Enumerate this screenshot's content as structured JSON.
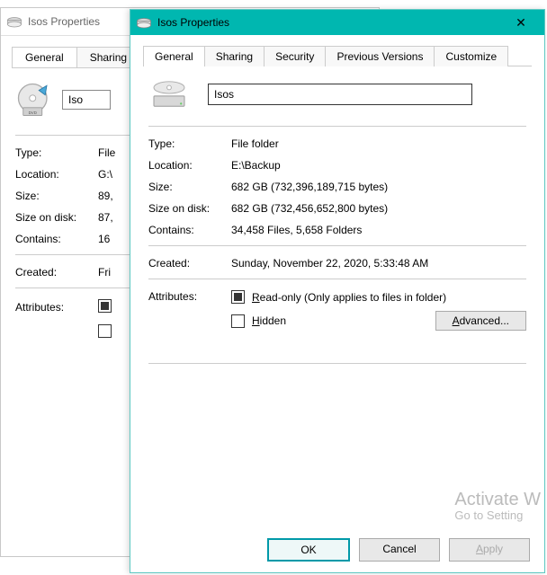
{
  "back": {
    "title": "Isos Properties",
    "tabs": {
      "general": "General",
      "sharing": "Sharing"
    },
    "name": "Iso",
    "type_label": "Type:",
    "type_value": "File",
    "location_label": "Location:",
    "location_value": "G:\\",
    "size_label": "Size:",
    "size_value": "89,",
    "disk_label": "Size on disk:",
    "disk_value": "87,",
    "contains_label": "Contains:",
    "contains_value": "16",
    "created_label": "Created:",
    "created_value": "Fri",
    "attributes_label": "Attributes:"
  },
  "front": {
    "title": "Isos Properties",
    "tabs": {
      "general": "General",
      "sharing": "Sharing",
      "security": "Security",
      "previous": "Previous Versions",
      "customize": "Customize"
    },
    "name": "Isos",
    "type_label": "Type:",
    "type_value": "File folder",
    "location_label": "Location:",
    "location_value": "E:\\Backup",
    "size_label": "Size:",
    "size_value": "682 GB (732,396,189,715 bytes)",
    "disk_label": "Size on disk:",
    "disk_value": "682 GB (732,456,652,800 bytes)",
    "contains_label": "Contains:",
    "contains_value": "34,458 Files, 5,658 Folders",
    "created_label": "Created:",
    "created_value": "Sunday, November 22, 2020, 5:33:48 AM",
    "attributes_label": "Attributes:",
    "readonly_label": "ead-only (Only applies to files in folder)",
    "readonly_prefix": "R",
    "hidden_label": "idden",
    "hidden_prefix": "H",
    "advanced_prefix": "A",
    "advanced_label": "dvanced...",
    "ok": "OK",
    "cancel": "Cancel",
    "apply_prefix": "A",
    "apply_label": "pply"
  },
  "watermark": {
    "line1": "Activate W",
    "line2": "Go to Setting"
  }
}
